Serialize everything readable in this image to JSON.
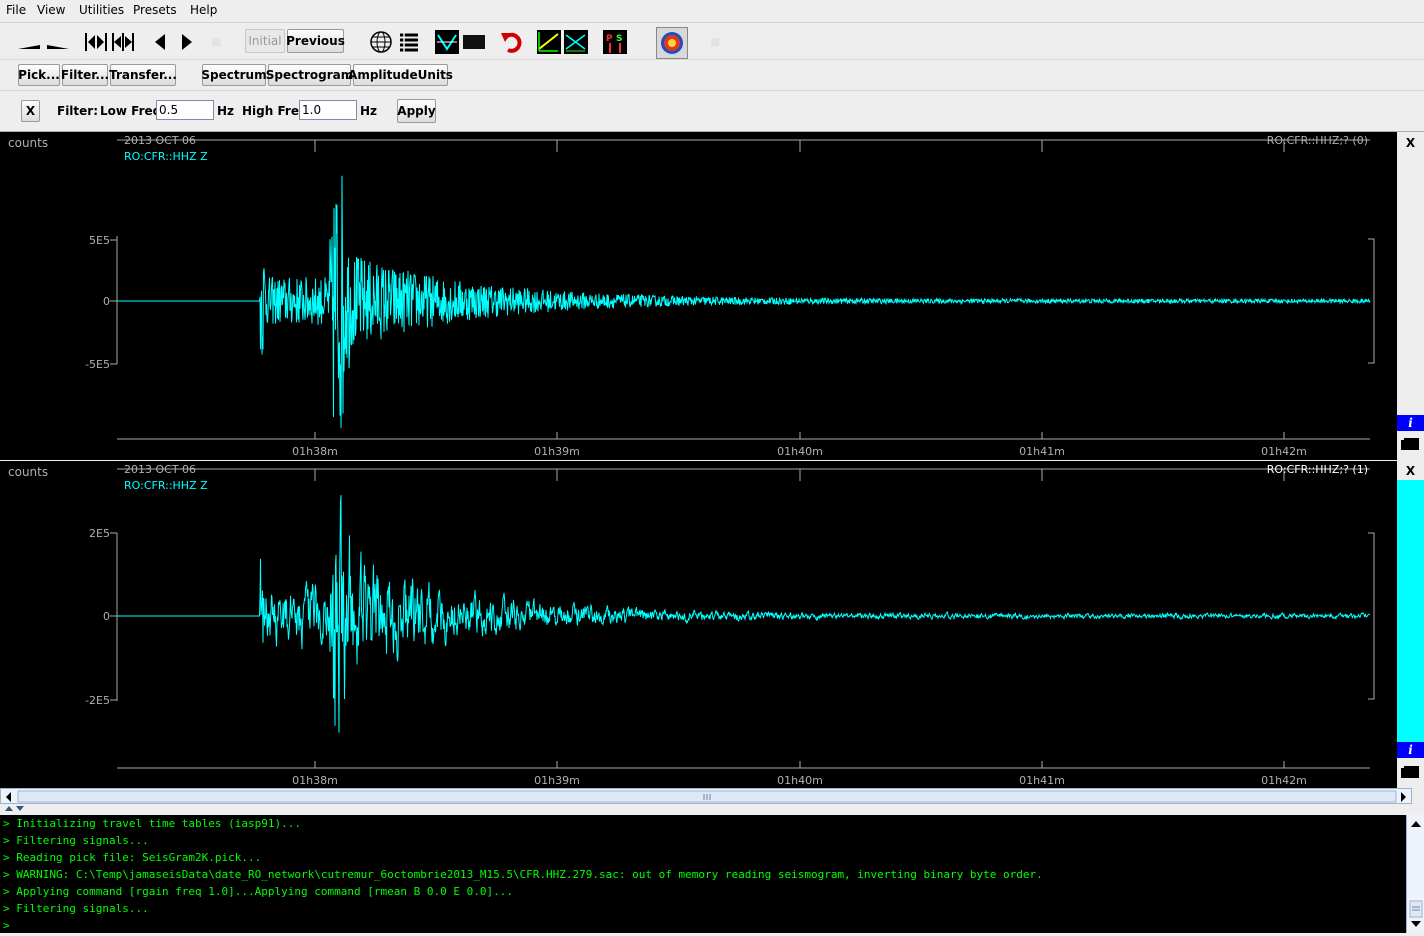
{
  "menu": [
    "File",
    "View",
    "Utilities",
    "Presets",
    "Help"
  ],
  "toolbar": {
    "initial_label": "Initial",
    "previous_label": "Previous"
  },
  "actions": [
    "Pick...",
    "Filter...",
    "Transfer...",
    "Spectrum",
    "Spectrogram",
    "AmplitudeUnits"
  ],
  "filter_bar": {
    "close_label": "X",
    "filter_label": "Filter:",
    "low_label": "Low Freq:",
    "low_value": "0.5",
    "low_unit": "Hz",
    "high_label": "High Freq:",
    "high_value": "1.0",
    "high_unit": "Hz",
    "apply_label": "Apply"
  },
  "traces": [
    {
      "units": "counts",
      "date": "2013 OCT 06",
      "station": "RO:CFR::HHZ Z",
      "id": "RO:CFR::HHZ;? (0)",
      "y_ticks": [
        "5E5",
        "0",
        "-5E5"
      ],
      "x_ticks": [
        "01h38m",
        "01h39m",
        "01h40m",
        "01h41m",
        "01h42m"
      ],
      "close_label": "X",
      "info_label": "i"
    },
    {
      "units": "counts",
      "date": "2013 OCT 06",
      "station": "RO:CFR::HHZ Z",
      "id": "RO:CFR::HHZ;? (1)",
      "y_ticks": [
        "2E5",
        "0",
        "-2E5"
      ],
      "x_ticks": [
        "01h38m",
        "01h39m",
        "01h40m",
        "01h41m",
        "01h42m"
      ],
      "close_label": "X",
      "info_label": "i"
    }
  ],
  "console": [
    "> Initializing travel time tables (iasp91)...",
    "> Filtering signals...",
    "> Reading pick file: SeisGram2K.pick...",
    "> WARNING: C:\\Temp\\jamaseisData\\date_RO_network\\cutremur_6octombrie2013_M15.5\\CFR.HHZ.279.sac: out of memory reading seismogram, inverting binary byte order.",
    "> Applying command [rgain freq 1.0]...Applying command [rmean B 0.0 E 0.0]...",
    "> Filtering signals...",
    ">"
  ],
  "colors": {
    "trace": "#00ffff",
    "axis": "#ffffff",
    "label": "#b0b0b0",
    "console_text": "#00ff00"
  },
  "icons": [
    "zoom-out-icon",
    "zoom-in-icon",
    "fit-start-icon",
    "fit-all-icon",
    "previous-icon",
    "next-icon",
    "map-icon",
    "list-icon",
    "align-icon",
    "stop-icon",
    "undo-icon",
    "rotate-icon",
    "particle-motion-icon",
    "ps-icon",
    "logo-icon"
  ]
}
